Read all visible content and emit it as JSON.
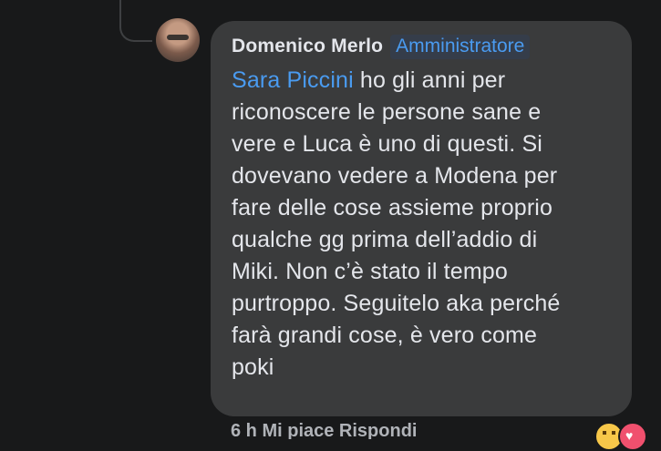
{
  "comment": {
    "author": "Domenico Merlo",
    "badge": "Amministratore",
    "mention": "Sara Piccini",
    "text_lines": [
      " ho gli anni per",
      "riconoscere le persone sane e",
      "vere e Luca è uno di questi. Si",
      "dovevano vedere a Modena per",
      "fare delle cose assieme proprio",
      "qualche gg prima dell’addio di",
      "Miki. Non c’è stato il tempo",
      "purtroppo. Seguitelo aka perché",
      "farà grandi cose, è vero come",
      "poki"
    ]
  },
  "footer": {
    "partial_text": "6 h   Mi piace   Rispondi"
  },
  "reactions": [
    "haha-icon",
    "love-icon"
  ]
}
